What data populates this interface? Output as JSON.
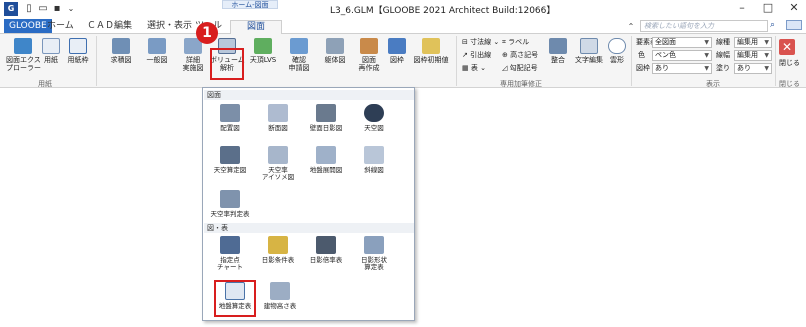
{
  "window": {
    "title": "L3_6.GLM【GLOOBE 2021 Architect Build:12066】",
    "context_group": "ホーム-図面",
    "minimize": "–",
    "maximize": "□",
    "close": "✕"
  },
  "tabs": [
    {
      "label": "GLOOBE"
    },
    {
      "label": "ホーム"
    },
    {
      "label": "ＣＡＤ編集"
    },
    {
      "label": "選択・表示"
    },
    {
      "label": "ツール"
    },
    {
      "label": "図面"
    }
  ],
  "help_search": {
    "placeholder": "検索したい語句を入力"
  },
  "ribbon": {
    "buttons": [
      {
        "label": "図面エクス\nプローラー"
      },
      {
        "label": "用紙"
      },
      {
        "label": "用紙枠"
      },
      {
        "label": "求積図"
      },
      {
        "label": "一般図"
      },
      {
        "label": "詳細\n実施図"
      },
      {
        "label": "ボリューム\n解析"
      },
      {
        "label": "天頂LVS"
      },
      {
        "label": "確認\n申請図"
      },
      {
        "label": "躯体図"
      },
      {
        "label": "図面\n再作成"
      },
      {
        "label": "図枠"
      },
      {
        "label": "図枠初期値"
      }
    ],
    "group_labels": {
      "paper": "用紙",
      "dedicated": "専用加筆修正",
      "display": "表示",
      "close": "閉じる"
    },
    "edit_tools": [
      {
        "label": "寸法線"
      },
      {
        "label": "ラベル"
      },
      {
        "label": "引出線"
      },
      {
        "label": "高さ記号"
      },
      {
        "label": "表"
      },
      {
        "label": "勾配記号"
      },
      {
        "label": "整合"
      },
      {
        "label": "文字編集"
      },
      {
        "label": "雲形"
      }
    ],
    "display": {
      "element_label": "要素表",
      "element_value": "全図面",
      "color_label": "色",
      "color_value": "ペン色",
      "frame_label": "図枠",
      "frame_value": "あり",
      "linetype_label": "線種",
      "linetype_value": "編集用",
      "linewidth_label": "線幅",
      "linewidth_value": "編集用",
      "fill_label": "塗り",
      "fill_value": "あり"
    },
    "close_label": "閉じる"
  },
  "badge": {
    "number": "1"
  },
  "dropdown": {
    "section_drawing": "図面",
    "section_table": "図・表",
    "items_row1": [
      {
        "label": "配置図"
      },
      {
        "label": "断面図"
      },
      {
        "label": "壁面日影図"
      },
      {
        "label": "天空図"
      }
    ],
    "items_row2": [
      {
        "label": "天空算定図"
      },
      {
        "label": "天空率\nアイソメ図"
      },
      {
        "label": "地盤展開図"
      },
      {
        "label": "斜線図"
      }
    ],
    "items_row3": [
      {
        "label": "天空率判定表"
      }
    ],
    "items_row4": [
      {
        "label": "指定点\nチャート"
      },
      {
        "label": "日影条件表"
      },
      {
        "label": "日影倍率表"
      },
      {
        "label": "日影形状\n算定表"
      }
    ],
    "items_row5": [
      {
        "label": "地盤算定表"
      },
      {
        "label": "建物高さ表"
      }
    ]
  },
  "colors": {
    "accent": "#2b6cc4",
    "highlight": "#d81e1e"
  }
}
